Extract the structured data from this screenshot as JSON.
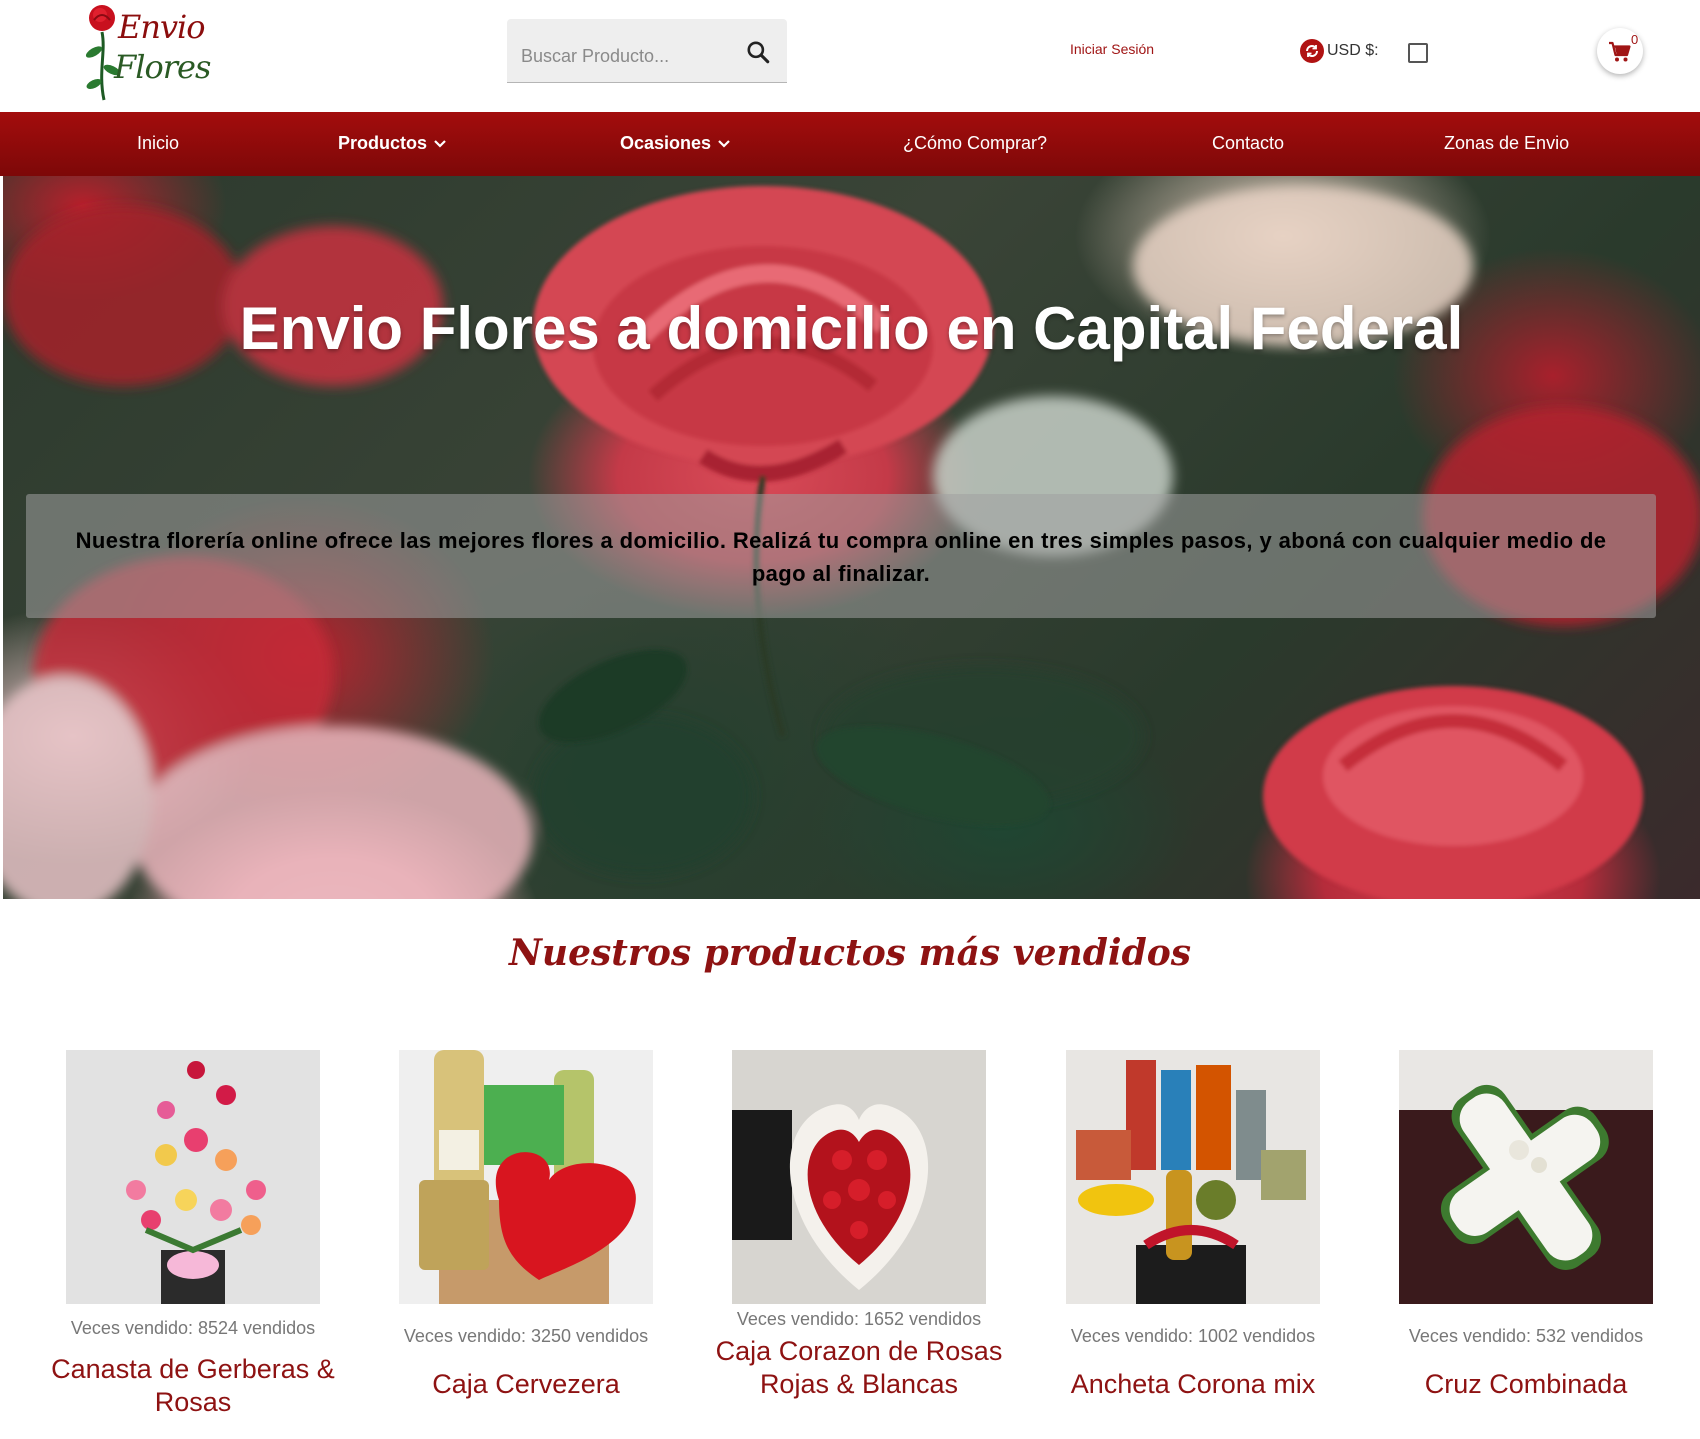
{
  "header": {
    "logo_line1": "Envio",
    "logo_line2": "Flores",
    "search_placeholder": "Buscar Producto...",
    "login_label": "Iniciar Sesión",
    "currency_label": "USD $:",
    "cart_count": "0"
  },
  "nav": {
    "items": [
      {
        "label": "Inicio"
      },
      {
        "label": "Productos"
      },
      {
        "label": "Ocasiones"
      },
      {
        "label": "¿Cómo Comprar?"
      },
      {
        "label": "Contacto"
      },
      {
        "label": "Zonas de Envio"
      }
    ]
  },
  "hero": {
    "title": "Envio Flores a domicilio en Capital Federal",
    "text": "Nuestra florería online ofrece las mejores flores a domicilio. Realizá tu compra online en tres simples pasos, y aboná con cualquier medio de pago al finalizar."
  },
  "bestsellers": {
    "title": "Nuestros productos más vendidos",
    "products": [
      {
        "sold": "Veces vendido: 8524 vendidos",
        "name": "Canasta de Gerberas & Rosas"
      },
      {
        "sold": "Veces vendido: 3250 vendidos",
        "name": "Caja Cervezera"
      },
      {
        "sold": "Veces vendido: 1652 vendidos",
        "name": "Caja Corazon de Rosas Rojas & Blancas"
      },
      {
        "sold": "Veces vendido: 1002 vendidos",
        "name": "Ancheta Corona mix"
      },
      {
        "sold": "Veces vendido: 532 vendidos",
        "name": "Cruz Combinada"
      }
    ]
  },
  "colors": {
    "brand_red": "#8e1212",
    "nav_red": "#a30d0d"
  }
}
